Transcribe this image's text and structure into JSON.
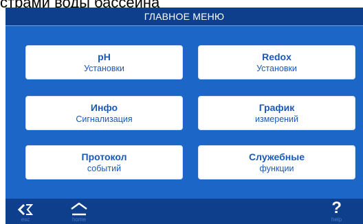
{
  "caption": "стрaми воды бассейна",
  "header": {
    "title": "ГЛАВНОЕ МЕНЮ"
  },
  "menu": {
    "items": [
      {
        "line1": "pH",
        "line2": "Установки"
      },
      {
        "line1": "Redox",
        "line2": "Установки"
      },
      {
        "line1": "Инфо",
        "line2": "Сигнализация"
      },
      {
        "line1": "График",
        "line2": "измерений"
      },
      {
        "line1": "Протокол",
        "line2": "событий"
      },
      {
        "line1": "Служебные",
        "line2": "функции"
      }
    ]
  },
  "footer": {
    "esc_label": "esc",
    "home_label": "home",
    "help_symbol": "?",
    "help_label": "help"
  },
  "colors": {
    "panel_blue": "#1b66c6",
    "bar_dark_blue": "#0d3f8c",
    "button_text": "#1a58b8",
    "button_bg": "#ffffff"
  },
  "icons": {
    "esc": "back-arrow-icon",
    "home": "home-icon",
    "help": "help-icon"
  }
}
